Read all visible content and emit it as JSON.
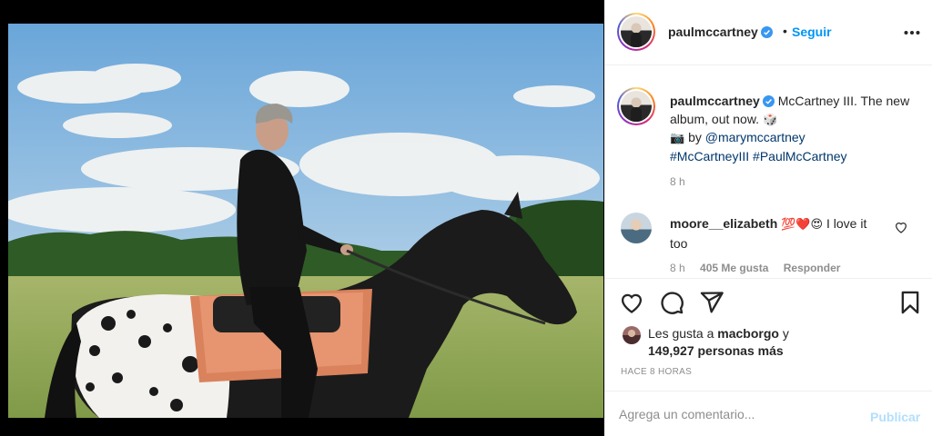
{
  "post": {
    "username": "paulmccartney",
    "verified": true,
    "separator": "•",
    "follow_label": "Seguir",
    "more_icon": "more-options-icon"
  },
  "caption": {
    "username": "paulmccartney",
    "text_1": "McCartney III. The new album, out now.",
    "emoji_1": "🎲",
    "camera_emoji": "📷",
    "by": "by",
    "mention": "@marymccartney",
    "hashtag_1": "#McCartneyIII",
    "hashtag_2": "#PaulMcCartney",
    "time": "8 h"
  },
  "comment": {
    "username": "moore__elizabeth",
    "emojis": "💯❤️😍",
    "text": "I love it too",
    "time": "8 h",
    "likes": "405 Me gusta",
    "reply_label": "Responder"
  },
  "likes": {
    "prefix": "Les gusta a",
    "user": "macborgo",
    "conj": "y",
    "count": "149,927 personas más"
  },
  "age": "HACE 8 HORAS",
  "add_comment": {
    "placeholder": "Agrega un comentario...",
    "publish_label": "Publicar"
  },
  "colors": {
    "link": "#00376b",
    "follow": "#0095f6",
    "publish_disabled": "#b2dffc",
    "muted": "#8e8e8e"
  }
}
